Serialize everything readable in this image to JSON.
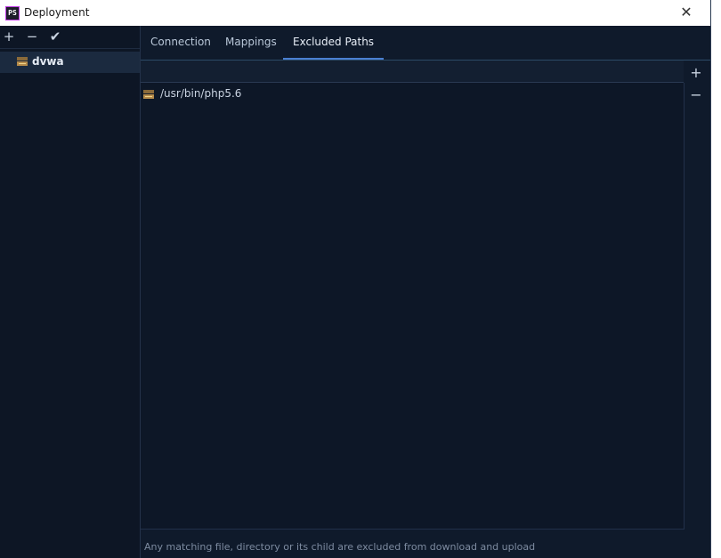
{
  "window": {
    "title": "Deployment",
    "app_icon_text": "PS",
    "close_symbol": "✕"
  },
  "left_toolbar": {
    "add_symbol": "+",
    "remove_symbol": "−",
    "check_symbol": "✔"
  },
  "servers": [
    {
      "label": "dvwa",
      "icon": "server-icon"
    }
  ],
  "tabs": [
    {
      "label": "Connection"
    },
    {
      "label": "Mappings"
    },
    {
      "label": "Excluded Paths"
    }
  ],
  "active_tab": "Excluded Paths",
  "excluded_paths": [
    {
      "path": "/usr/bin/php5.6",
      "icon": "server-folder-icon"
    }
  ],
  "side_toolbar": {
    "add_symbol": "+",
    "remove_symbol": "−"
  },
  "hint": "Any matching file, directory or its child are excluded from download and upload",
  "colors": {
    "background": "#0f1a2b",
    "accent": "#4a7fd1",
    "text": "#c9d3e1"
  }
}
